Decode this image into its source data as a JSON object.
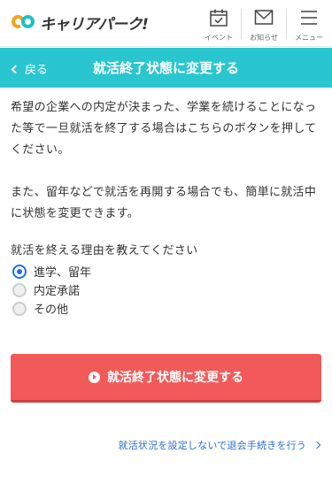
{
  "header": {
    "logo_text": "キャリアパーク!",
    "nav": [
      {
        "label": "イベント",
        "icon": "calendar-icon"
      },
      {
        "label": "お知らせ",
        "icon": "mail-icon"
      },
      {
        "label": "メニュー",
        "icon": "menu-icon"
      }
    ]
  },
  "titlebar": {
    "back_label": "戻る",
    "title": "就活終了状態に変更する",
    "color": "#29c6cf"
  },
  "body": {
    "para1": "希望の企業への内定が決まった、学業を続けることになった等で一旦就活を終了する場合はこちらのボタンを押してください。",
    "para2": "また、留年などで就活を再開する場合でも、簡単に就活中に状態を変更できます。",
    "question": "就活を終える理由を教えてください",
    "options": [
      {
        "label": "進学、留年",
        "checked": true
      },
      {
        "label": "内定承諾",
        "checked": false
      },
      {
        "label": "その他",
        "checked": false
      }
    ]
  },
  "submit": {
    "label": "就活終了状態に変更する",
    "color": "#f25a5a"
  },
  "withdraw_link": "就活状況を設定しないで退会手続きを行う"
}
